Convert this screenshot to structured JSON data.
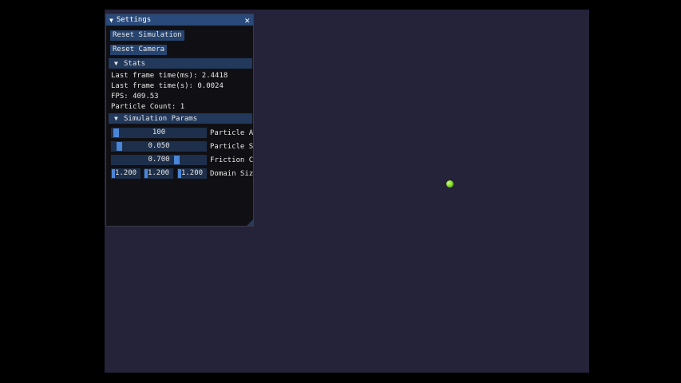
{
  "window": {
    "title": "Settings",
    "close_glyph": "✕",
    "collapse_glyph": "▼"
  },
  "buttons": {
    "reset_simulation": "Reset Simulation",
    "reset_camera": "Reset Camera"
  },
  "stats": {
    "header": "Stats",
    "frame_time_ms": "Last frame time(ms): 2.4418",
    "frame_time_s": "Last frame time(s): 0.0024",
    "fps": "FPS: 409.53",
    "particle_count": "Particle Count: 1"
  },
  "sim_params": {
    "header": "Simulation Params",
    "particle_amount": {
      "value": "100",
      "label": "Particle A",
      "fraction": 0.02
    },
    "particle_size": {
      "value": "0.050",
      "label": "Particle S",
      "fraction": 0.05
    },
    "friction": {
      "value": "0.700",
      "label": "Friction C",
      "fraction": 0.7
    },
    "domain_size": {
      "values": [
        "1.200",
        "1.200",
        "1.200"
      ],
      "label": "Domain Siz"
    }
  },
  "colors": {
    "title_bar": "#294a7a",
    "button": "#26446e",
    "slider_grab": "#4a86d8",
    "viewport": "#24233a",
    "particle": "#7ed321"
  }
}
